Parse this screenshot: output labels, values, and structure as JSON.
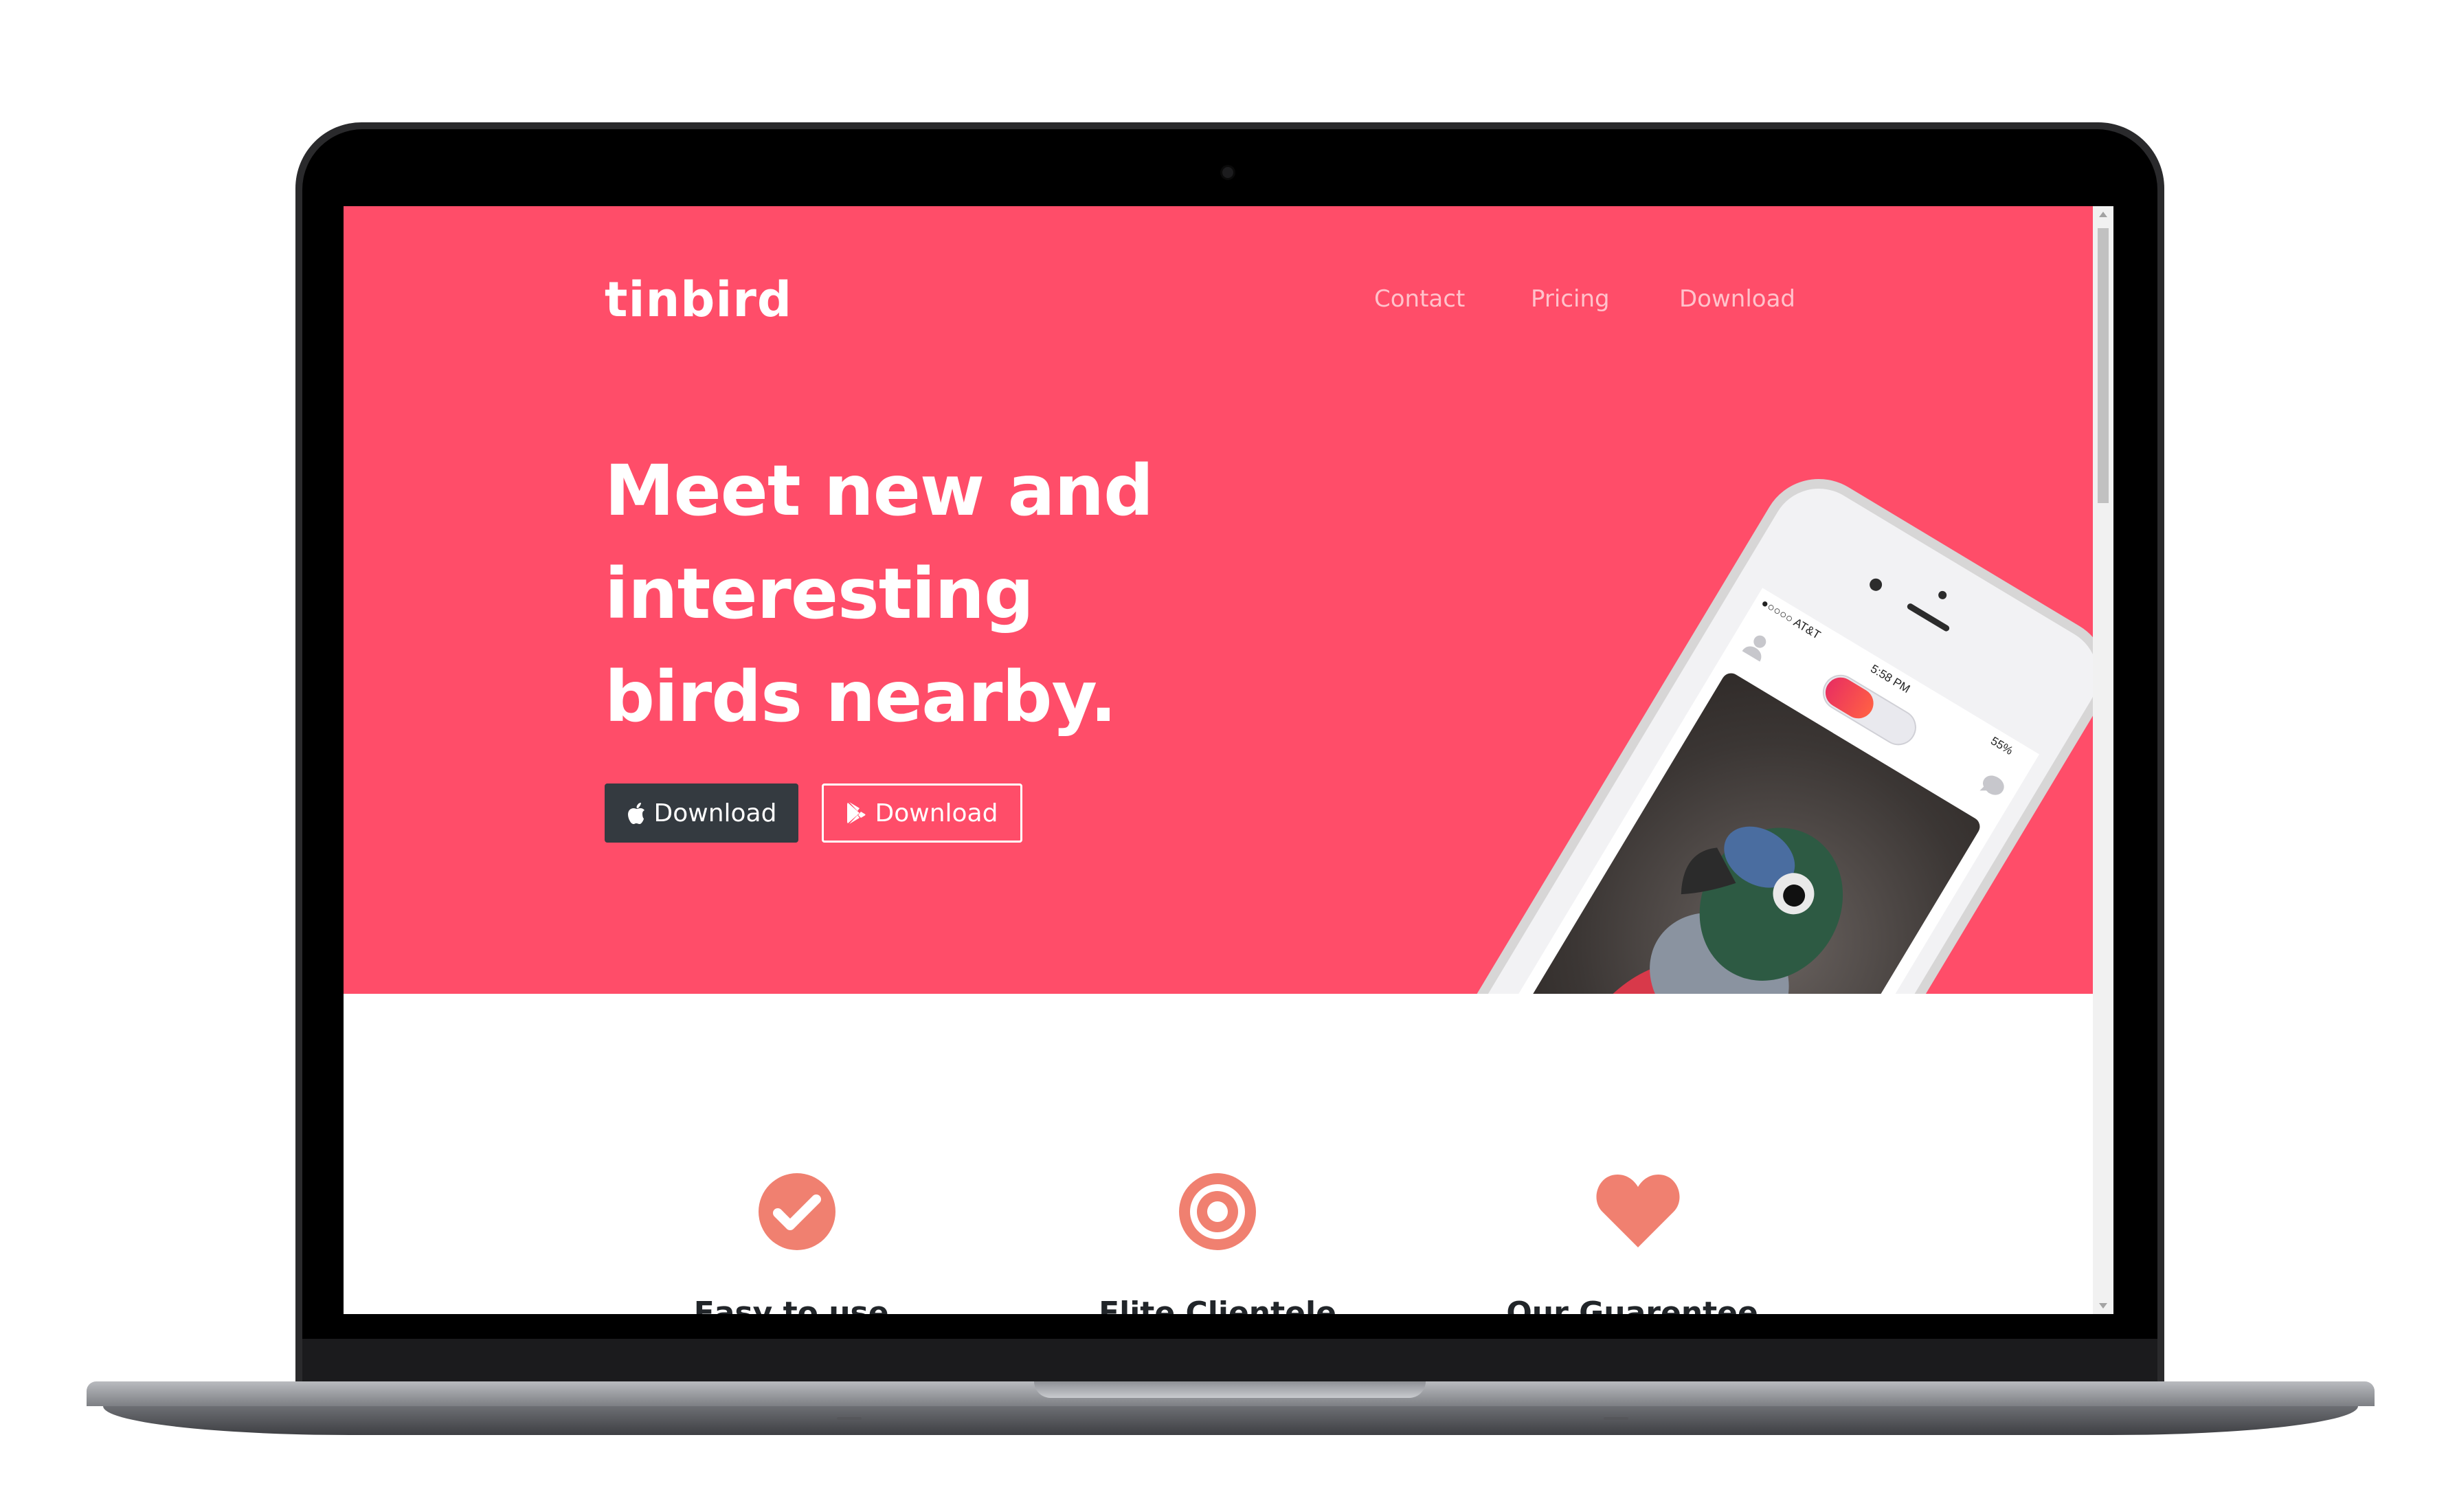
{
  "site": {
    "logo": "tinbird",
    "brand_color": "#ff4d69",
    "nav": [
      {
        "label": "Contact"
      },
      {
        "label": "Pricing"
      },
      {
        "label": "Download"
      }
    ]
  },
  "hero": {
    "headline_lines": [
      "Meet new and",
      "interesting",
      "birds nearby."
    ],
    "buttons": [
      {
        "label": "Download",
        "icon": "apple-icon"
      },
      {
        "label": "Download",
        "icon": "google-play-icon"
      }
    ]
  },
  "phone": {
    "carrier": "●○○○○ AT&T",
    "time": "5:58 PM",
    "battery": "55%",
    "photo": "parrot-photo"
  },
  "features": [
    {
      "title": "Easy to use.",
      "icon": "check-circle-icon",
      "color": "#f08070"
    },
    {
      "title": "Elite Clientele",
      "icon": "target-icon",
      "color": "#f08070"
    },
    {
      "title": "Our Guarentee.",
      "icon": "heart-icon",
      "color": "#f08070"
    }
  ]
}
